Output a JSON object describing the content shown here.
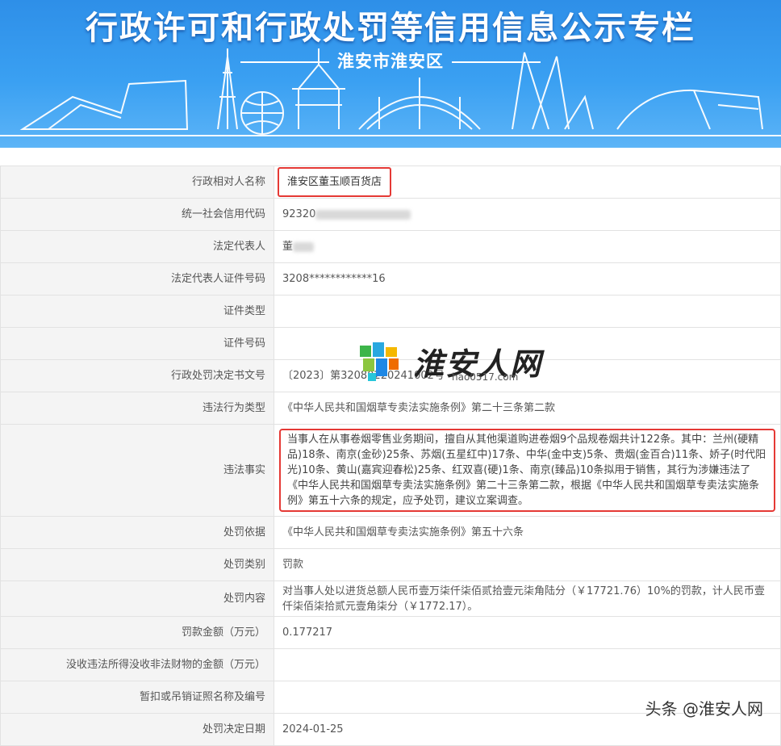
{
  "banner": {
    "title": "行政许可和行政处罚等信用信息公示专栏",
    "subtitle": "淮安市淮安区"
  },
  "rows": [
    {
      "label": "行政相对人名称",
      "value": "淮安区董玉顺百货店",
      "highlight": true
    },
    {
      "label": "统一社会信用代码",
      "value": "92320",
      "redacted": true
    },
    {
      "label": "法定代表人",
      "value": "董",
      "redacted": true
    },
    {
      "label": "法定代表人证件号码",
      "value": "3208************16"
    },
    {
      "label": "证件类型",
      "value": ""
    },
    {
      "label": "证件号码",
      "value": ""
    },
    {
      "label": "行政处罚决定书文号",
      "value": "〔2023〕第32080220241002号"
    },
    {
      "label": "违法行为类型",
      "value": "《中华人民共和国烟草专卖法实施条例》第二十三条第二款"
    },
    {
      "label": "违法事实",
      "value": "当事人在从事卷烟零售业务期间，擅自从其他渠道购进卷烟9个品规卷烟共计122条。其中：兰州(硬精品)18条、南京(金砂)25条、苏烟(五星红中)17条、中华(金中支)5条、贵烟(金百合)11条、娇子(时代阳光)10条、黄山(嘉宾迎春松)25条、红双喜(硬)1条、南京(臻品)10条拟用于销售，其行为涉嫌违法了《中华人民共和国烟草专卖法实施条例》第二十三条第二款，根据《中华人民共和国烟草专卖法实施条例》第五十六条的规定，应予处罚，建议立案调查。",
      "highlight": true
    },
    {
      "label": "处罚依据",
      "value": "《中华人民共和国烟草专卖法实施条例》第五十六条"
    },
    {
      "label": "处罚类别",
      "value": "罚款"
    },
    {
      "label": "处罚内容",
      "value": "对当事人处以进货总额人民币壹万柒仟柒佰贰拾壹元柒角陆分（￥17721.76）10%的罚款，计人民币壹仟柒佰柒拾贰元壹角柒分（￥1772.17）。"
    },
    {
      "label": "罚款金额（万元）",
      "value": "0.177217"
    },
    {
      "label": "没收违法所得没收非法财物的金额（万元）",
      "value": ""
    },
    {
      "label": "暂扣或吊销证照名称及编号",
      "value": ""
    },
    {
      "label": "处罚决定日期",
      "value": "2024-01-25"
    }
  ],
  "watermark": {
    "brand": "淮安人网",
    "url": "hao0517.com",
    "corner": "头条 @淮安人网"
  },
  "colors": {
    "banner": "#2e8fe8",
    "highlight_border": "#e53935",
    "label_bg": "#f4f4f4"
  }
}
